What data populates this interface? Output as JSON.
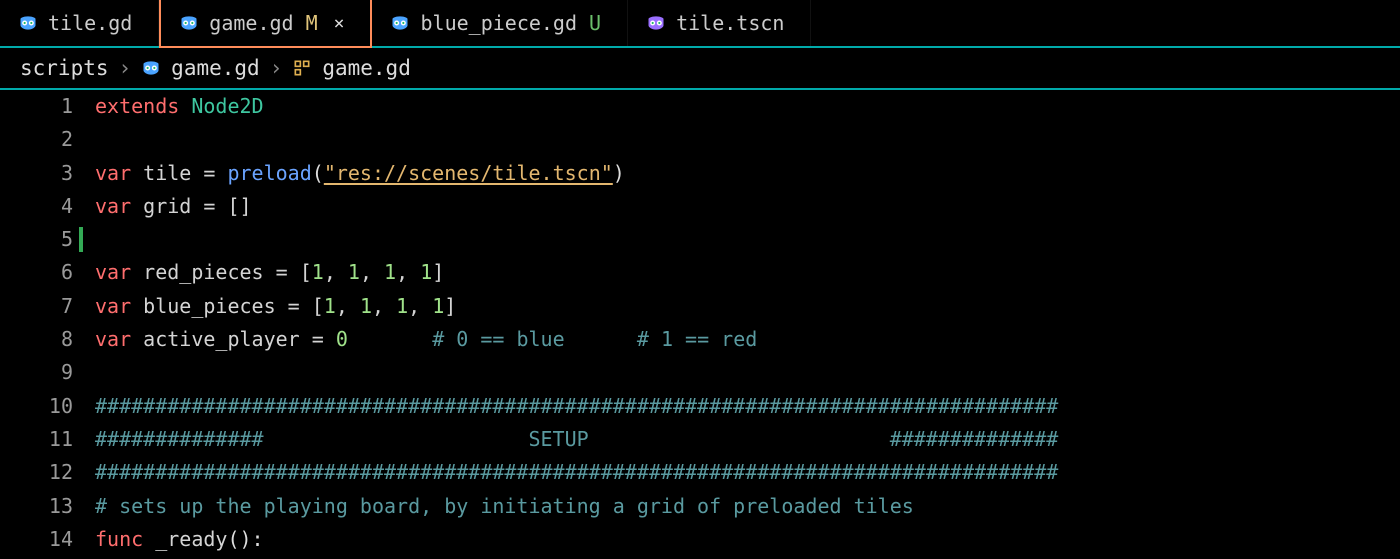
{
  "tabs": [
    {
      "label": "tile.gd",
      "status": "",
      "iconColor": "#4aa3ff",
      "active": false
    },
    {
      "label": "game.gd",
      "status": "M",
      "iconColor": "#4aa3ff",
      "active": true,
      "close": "×"
    },
    {
      "label": "blue_piece.gd",
      "status": "U",
      "iconColor": "#4aa3ff",
      "active": false
    },
    {
      "label": "tile.tscn",
      "status": "",
      "iconColor": "#9a6fff",
      "active": false
    }
  ],
  "breadcrumbs": {
    "root": "scripts",
    "file": "game.gd",
    "symbol": "game.gd",
    "sep": "›"
  },
  "cursor_line": 5,
  "lines": [
    {
      "n": 1,
      "tokens": [
        [
          "kw",
          "extends"
        ],
        [
          "op",
          " "
        ],
        [
          "type",
          "Node2D"
        ]
      ]
    },
    {
      "n": 2,
      "tokens": []
    },
    {
      "n": 3,
      "tokens": [
        [
          "kw",
          "var"
        ],
        [
          "op",
          " "
        ],
        [
          "ident",
          "tile"
        ],
        [
          "op",
          " = "
        ],
        [
          "builtin",
          "preload"
        ],
        [
          "punct",
          "("
        ],
        [
          "string underline",
          "\"res://scenes/tile.tscn\""
        ],
        [
          "punct",
          ")"
        ]
      ]
    },
    {
      "n": 4,
      "tokens": [
        [
          "kw",
          "var"
        ],
        [
          "op",
          " "
        ],
        [
          "ident",
          "grid"
        ],
        [
          "op",
          " = []"
        ]
      ]
    },
    {
      "n": 5,
      "tokens": []
    },
    {
      "n": 6,
      "tokens": [
        [
          "kw",
          "var"
        ],
        [
          "op",
          " "
        ],
        [
          "ident",
          "red_pieces"
        ],
        [
          "op",
          " = ["
        ],
        [
          "num",
          "1"
        ],
        [
          "op",
          ", "
        ],
        [
          "num",
          "1"
        ],
        [
          "op",
          ", "
        ],
        [
          "num",
          "1"
        ],
        [
          "op",
          ", "
        ],
        [
          "num",
          "1"
        ],
        [
          "op",
          "]"
        ]
      ]
    },
    {
      "n": 7,
      "tokens": [
        [
          "kw",
          "var"
        ],
        [
          "op",
          " "
        ],
        [
          "ident",
          "blue_pieces"
        ],
        [
          "op",
          " = ["
        ],
        [
          "num",
          "1"
        ],
        [
          "op",
          ", "
        ],
        [
          "num",
          "1"
        ],
        [
          "op",
          ", "
        ],
        [
          "num",
          "1"
        ],
        [
          "op",
          ", "
        ],
        [
          "num",
          "1"
        ],
        [
          "op",
          "]"
        ]
      ]
    },
    {
      "n": 8,
      "tokens": [
        [
          "kw",
          "var"
        ],
        [
          "op",
          " "
        ],
        [
          "ident",
          "active_player"
        ],
        [
          "op",
          " = "
        ],
        [
          "num",
          "0"
        ],
        [
          "op",
          "       "
        ],
        [
          "comment",
          "# 0 == blue"
        ],
        [
          "op",
          "      "
        ],
        [
          "comment",
          "# 1 == red"
        ]
      ]
    },
    {
      "n": 9,
      "tokens": []
    },
    {
      "n": 10,
      "tokens": [
        [
          "comment",
          "################################################################################"
        ]
      ]
    },
    {
      "n": 11,
      "tokens": [
        [
          "comment",
          "##############                      SETUP                         ##############"
        ]
      ]
    },
    {
      "n": 12,
      "tokens": [
        [
          "comment",
          "################################################################################"
        ]
      ]
    },
    {
      "n": 13,
      "tokens": [
        [
          "comment",
          "# sets up the playing board, by initiating a grid of preloaded tiles"
        ]
      ]
    },
    {
      "n": 14,
      "tokens": [
        [
          "kw",
          "func"
        ],
        [
          "op",
          " "
        ],
        [
          "fn",
          "_ready"
        ],
        [
          "punct",
          "():"
        ]
      ]
    }
  ]
}
